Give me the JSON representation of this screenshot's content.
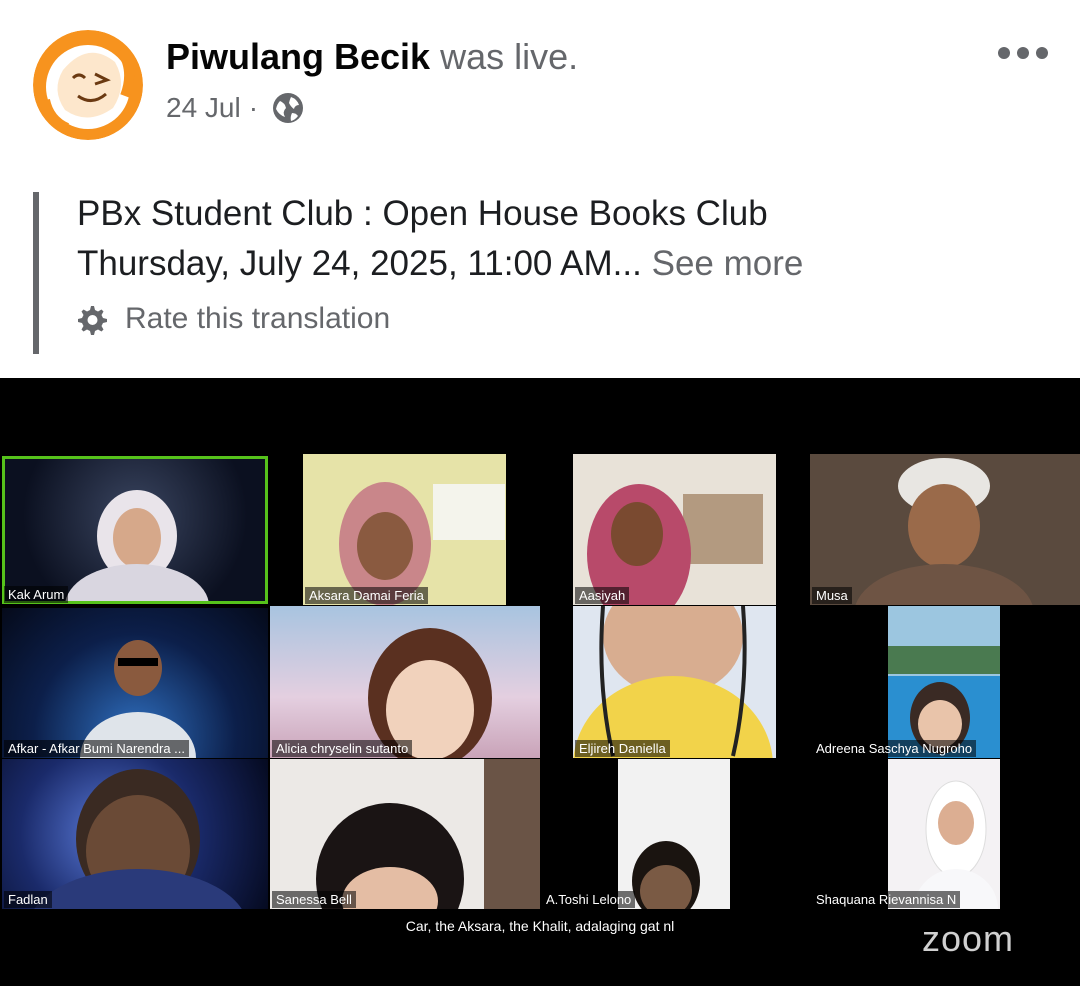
{
  "post": {
    "page_name": "Piwulang Becik",
    "status": "was live.",
    "date": "24 Jul",
    "separator": "·",
    "title_line": "PBx Student Club : Open House Books Club",
    "date_line": "Thursday, July 24, 2025, 11:00 AM...",
    "see_more": "See more",
    "rate_translation": "Rate this translation",
    "icons": [
      "avatar-logo",
      "globe-icon",
      "more-options-icon",
      "gear-icon"
    ]
  },
  "video": {
    "participants": [
      {
        "name": "Kak Arum",
        "active": true
      },
      {
        "name": "Aksara Damai Feria"
      },
      {
        "name": "Aasiyah"
      },
      {
        "name": "Musa"
      },
      {
        "name": "Afkar - Afkar Bumi Narendra ..."
      },
      {
        "name": "Alicia chryselin sutanto"
      },
      {
        "name": "Eljireh Daniella"
      },
      {
        "name": "Adreena Saschya Nugroho"
      },
      {
        "name": "Fadlan"
      },
      {
        "name": "Sanessa Bell"
      },
      {
        "name": "A.Toshi Lelono"
      },
      {
        "name": "Shaquana Rievannisa N"
      }
    ],
    "caption": "Car, the Aksara, the Khalit, adalaging gat nl",
    "brand": "zoom",
    "active_color": "#56c21b"
  }
}
